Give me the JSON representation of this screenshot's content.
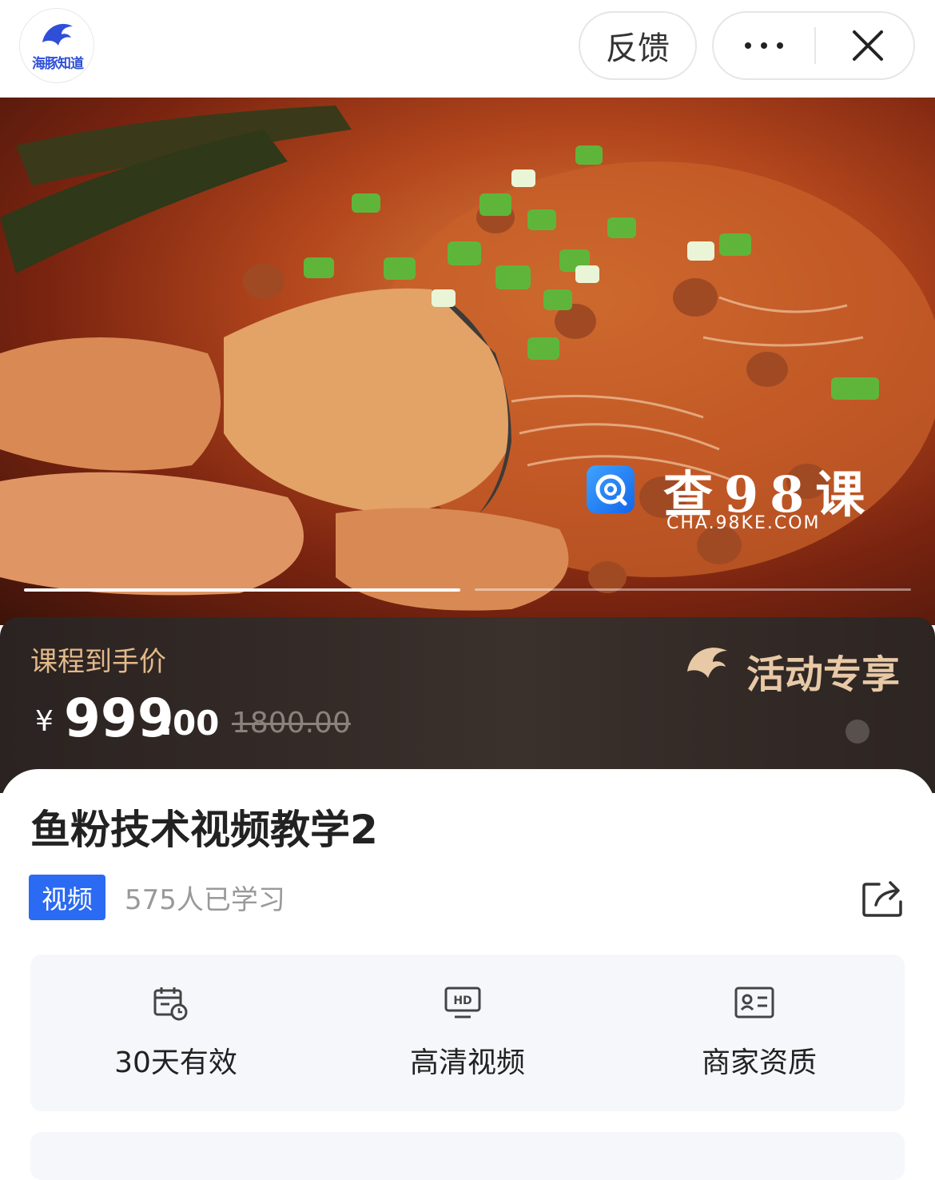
{
  "header": {
    "logo_text": "海豚知道",
    "feedback_label": "反馈"
  },
  "hero": {
    "watermark_text": "查98课",
    "watermark_sub": "CHA.98KE.COM",
    "slide_count": 2,
    "active_slide": 1
  },
  "price": {
    "label": "课程到手价",
    "currency": "¥",
    "integer": "999",
    "decimal": ".00",
    "original": "1800.00",
    "promo": "活动专享"
  },
  "course": {
    "title": "鱼粉技术视频教学2",
    "tag": "视频",
    "learners": "575人已学习"
  },
  "features": [
    {
      "icon": "calendar-clock-icon",
      "label": "30天有效"
    },
    {
      "icon": "hd-monitor-icon",
      "label": "高清视频"
    },
    {
      "icon": "id-card-icon",
      "label": "商家资质"
    }
  ],
  "colors": {
    "accent_blue": "#2b6af2",
    "price_band": "#2b2321",
    "gold": "#e2b98a"
  }
}
